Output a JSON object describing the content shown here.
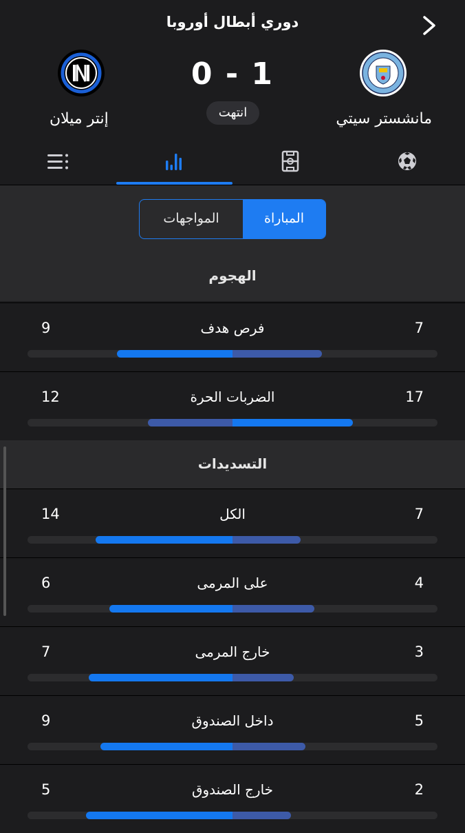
{
  "header": {
    "league": "دوري أبطال أوروبا",
    "score": "0 - 1",
    "status": "انتهت",
    "home_team": "مانشستر سيتي",
    "away_team": "إنتر ميلان"
  },
  "segment": {
    "active": "المباراة",
    "inactive": "المواجهات"
  },
  "sections": {
    "attack_title": "الهجوم",
    "shots_title": "التسديدات"
  },
  "stats": [
    {
      "name": "فرص هدف",
      "home": 7,
      "away": 9
    },
    {
      "name": "الضربات الحرة",
      "home": 17,
      "away": 12
    },
    {
      "name": "الكل",
      "home": 7,
      "away": 14
    },
    {
      "name": "على المرمى",
      "home": 4,
      "away": 6
    },
    {
      "name": "خارج المرمى",
      "home": 3,
      "away": 7
    },
    {
      "name": "داخل الصندوق",
      "home": 5,
      "away": 9
    },
    {
      "name": "خارج الصندوق",
      "home": 2,
      "away": 5
    }
  ],
  "colors": {
    "accent": "#1e7cf2",
    "lead_bar": "#1478f0",
    "other_bar": "#3d5aa8",
    "background": "#1c1c1e"
  },
  "icons": {
    "back": "chevron-right-icon",
    "tab_events": "soccer-ball-icon",
    "tab_lineup": "pitch-icon",
    "tab_stats": "bar-chart-icon",
    "tab_table": "list-icon"
  }
}
